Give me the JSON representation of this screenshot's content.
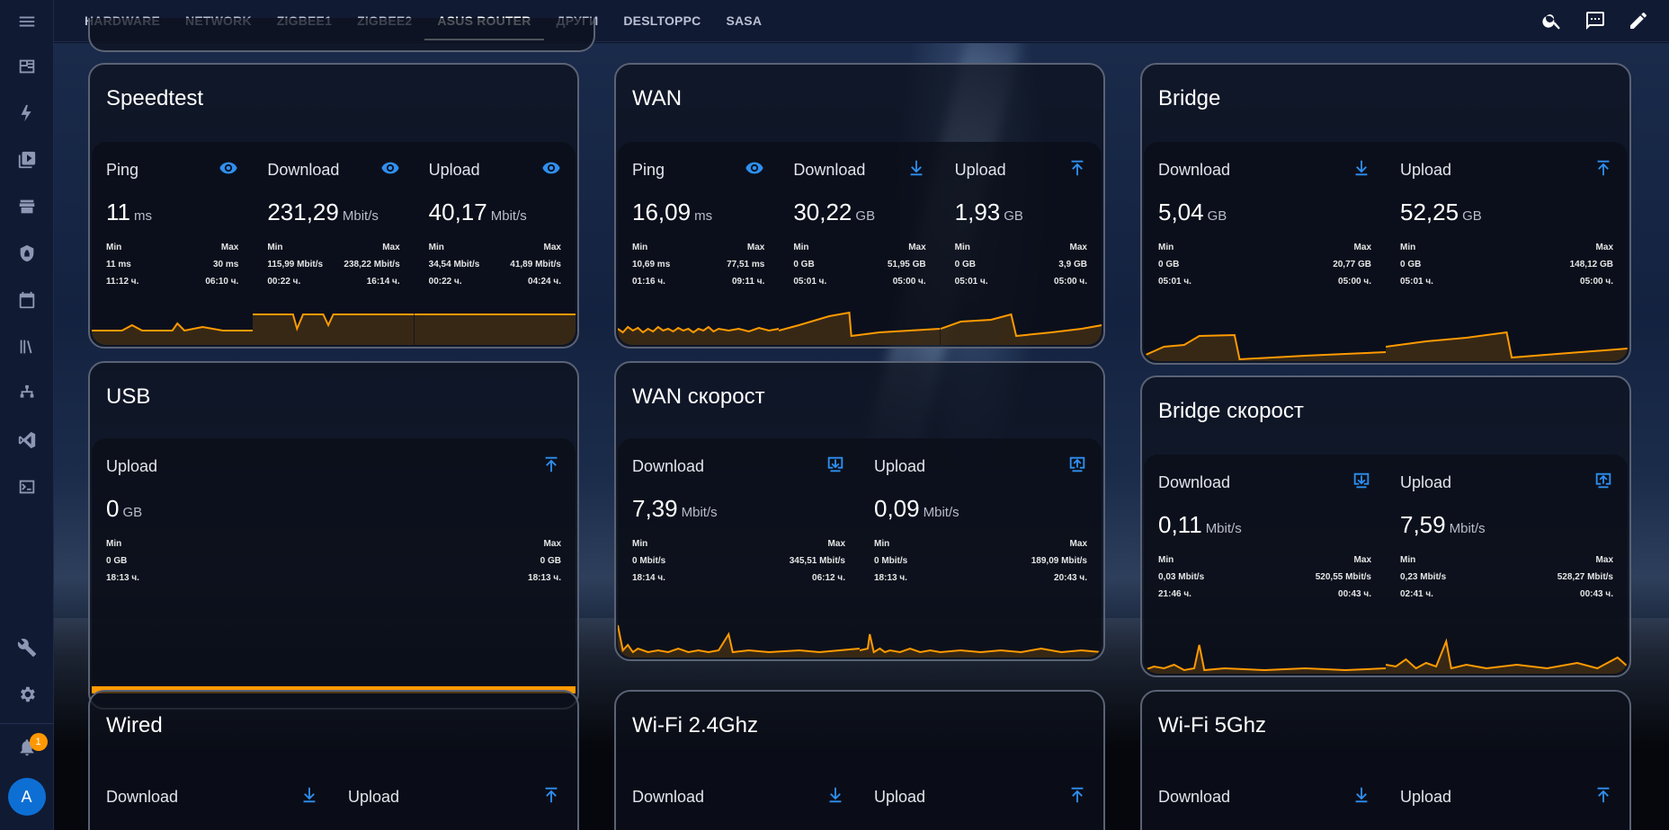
{
  "nav": {
    "tabs": [
      "HARDWARE",
      "NETWORK",
      "ZIGBEE1",
      "ZIGBEE2",
      "ASUS ROUTER",
      "ДРУГИ",
      "DESLTOPPC",
      "SASA"
    ],
    "active_tab": "ASUS ROUTER"
  },
  "sidebar": {
    "items": [
      "overview-icon",
      "energy-icon",
      "media-icon",
      "hacs-icon",
      "security-icon",
      "calendar-icon",
      "history-icon",
      "network-map-icon",
      "vscode-icon",
      "terminal-icon"
    ],
    "bottom": [
      "developer-tools-icon",
      "settings-icon"
    ],
    "notifications_count": "1",
    "user_initial": "A"
  },
  "colors": {
    "accent": "#2f8ff0",
    "graph": "#ff9a00",
    "card_border": "#5a6275"
  },
  "cards": {
    "speedtest": {
      "title": "Speedtest",
      "stats": [
        {
          "name": "Ping",
          "icon": "eye-icon",
          "value": "11",
          "unit": "ms",
          "min_label": "Min",
          "max_label": "Max",
          "min": "11 ms",
          "max": "30 ms",
          "min_time": "11:12 ч.",
          "max_time": "06:10 ч."
        },
        {
          "name": "Download",
          "icon": "eye-icon",
          "value": "231,29",
          "unit": "Mbit/s",
          "min_label": "Min",
          "max_label": "Max",
          "min": "115,99 Mbit/s",
          "max": "238,22 Mbit/s",
          "min_time": "00:22 ч.",
          "max_time": "16:14 ч."
        },
        {
          "name": "Upload",
          "icon": "eye-icon",
          "value": "40,17",
          "unit": "Mbit/s",
          "min_label": "Min",
          "max_label": "Max",
          "min": "34,54 Mbit/s",
          "max": "41,89 Mbit/s",
          "min_time": "00:22 ч.",
          "max_time": "04:24 ч."
        }
      ]
    },
    "wan": {
      "title": "WAN",
      "stats": [
        {
          "name": "Ping",
          "icon": "eye-icon",
          "value": "16,09",
          "unit": "ms",
          "min_label": "Min",
          "max_label": "Max",
          "min": "10,69 ms",
          "max": "77,51 ms",
          "min_time": "01:16 ч.",
          "max_time": "09:11 ч."
        },
        {
          "name": "Download",
          "icon": "download-icon",
          "value": "30,22",
          "unit": "GB",
          "min_label": "Min",
          "max_label": "Max",
          "min": "0 GB",
          "max": "51,95 GB",
          "min_time": "05:01 ч.",
          "max_time": "05:00 ч."
        },
        {
          "name": "Upload",
          "icon": "upload-icon",
          "value": "1,93",
          "unit": "GB",
          "min_label": "Min",
          "max_label": "Max",
          "min": "0 GB",
          "max": "3,9 GB",
          "min_time": "05:01 ч.",
          "max_time": "05:00 ч."
        }
      ]
    },
    "bridge": {
      "title": "Bridge",
      "stats": [
        {
          "name": "Download",
          "icon": "download-icon",
          "value": "5,04",
          "unit": "GB",
          "min_label": "Min",
          "max_label": "Max",
          "min": "0 GB",
          "max": "20,77 GB",
          "min_time": "05:01 ч.",
          "max_time": "05:00 ч."
        },
        {
          "name": "Upload",
          "icon": "upload-icon",
          "value": "52,25",
          "unit": "GB",
          "min_label": "Min",
          "max_label": "Max",
          "min": "0 GB",
          "max": "148,12 GB",
          "min_time": "05:01 ч.",
          "max_time": "05:00 ч."
        }
      ]
    },
    "usb": {
      "title": "USB",
      "stats": [
        {
          "name": "Upload",
          "icon": "upload-icon",
          "value": "0",
          "unit": "GB",
          "min_label": "Min",
          "max_label": "Max",
          "min": "0 GB",
          "max": "0 GB",
          "min_time": "18:13 ч.",
          "max_time": "18:13 ч."
        }
      ]
    },
    "wan_speed": {
      "title": "WAN скорост",
      "stats": [
        {
          "name": "Download",
          "icon": "download-box-icon",
          "value": "7,39",
          "unit": "Mbit/s",
          "min_label": "Min",
          "max_label": "Max",
          "min": "0 Mbit/s",
          "max": "345,51 Mbit/s",
          "min_time": "18:14 ч.",
          "max_time": "06:12 ч."
        },
        {
          "name": "Upload",
          "icon": "upload-box-icon",
          "value": "0,09",
          "unit": "Mbit/s",
          "min_label": "Min",
          "max_label": "Max",
          "min": "0 Mbit/s",
          "max": "189,09 Mbit/s",
          "min_time": "18:13 ч.",
          "max_time": "20:43 ч."
        }
      ]
    },
    "bridge_speed": {
      "title": "Bridge скорост",
      "stats": [
        {
          "name": "Download",
          "icon": "download-box-icon",
          "value": "0,11",
          "unit": "Mbit/s",
          "min_label": "Min",
          "max_label": "Max",
          "min": "0,03 Mbit/s",
          "max": "520,55 Mbit/s",
          "min_time": "21:46 ч.",
          "max_time": "00:43 ч."
        },
        {
          "name": "Upload",
          "icon": "upload-box-icon",
          "value": "7,59",
          "unit": "Mbit/s",
          "min_label": "Min",
          "max_label": "Max",
          "min": "0,23 Mbit/s",
          "max": "528,27 Mbit/s",
          "min_time": "02:41 ч.",
          "max_time": "00:43 ч."
        }
      ]
    },
    "wired": {
      "title": "Wired",
      "stats": [
        {
          "name": "Download",
          "icon": "download-icon"
        },
        {
          "name": "Upload",
          "icon": "upload-icon"
        }
      ]
    },
    "wifi24": {
      "title": "Wi-Fi 2.4Ghz",
      "stats": [
        {
          "name": "Download",
          "icon": "download-icon"
        },
        {
          "name": "Upload",
          "icon": "upload-icon"
        }
      ]
    },
    "wifi5": {
      "title": "Wi-Fi 5Ghz",
      "stats": [
        {
          "name": "Download",
          "icon": "download-icon"
        },
        {
          "name": "Upload",
          "icon": "upload-icon"
        }
      ]
    }
  }
}
